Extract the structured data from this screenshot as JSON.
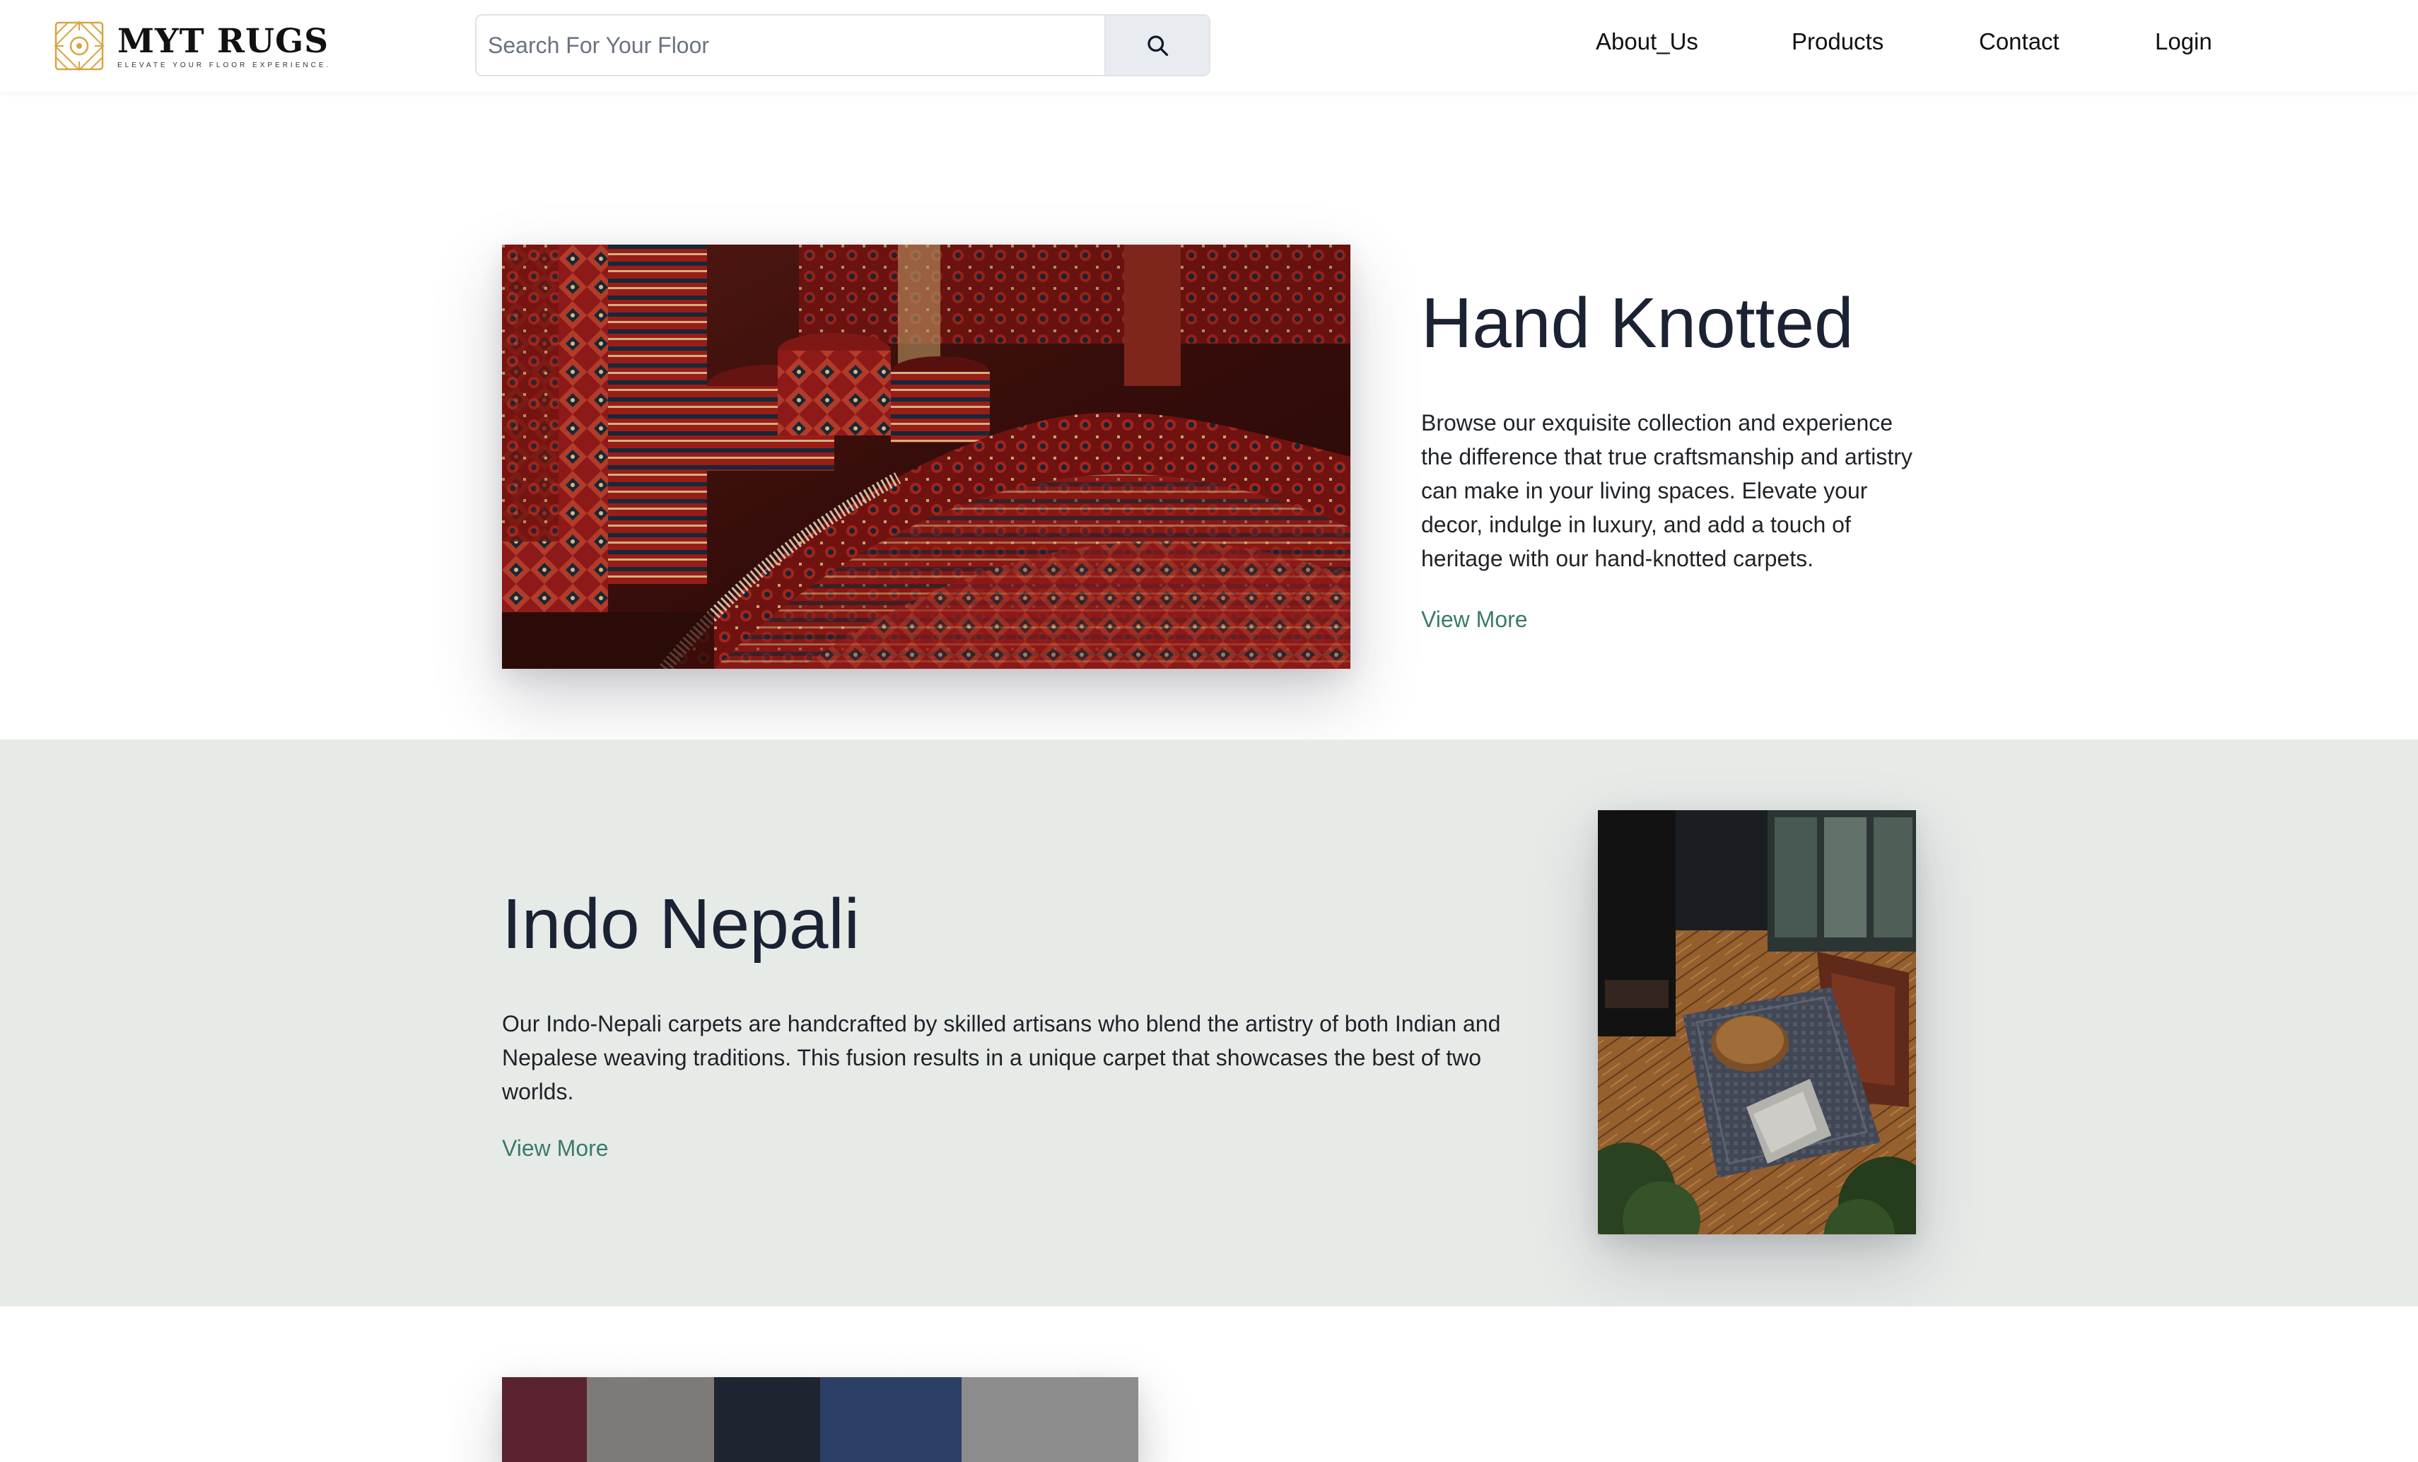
{
  "brand": {
    "name": "MYT RUGS",
    "tagline": "ELEVATE YOUR FLOOR EXPERIENCE.",
    "icon": "rug-pattern-logo-icon",
    "accent_color": "#d9a441"
  },
  "search": {
    "placeholder": "Search For Your Floor",
    "value": "",
    "button_icon": "search-icon"
  },
  "nav": {
    "items": [
      {
        "label": "About_Us"
      },
      {
        "label": "Products"
      },
      {
        "label": "Contact"
      },
      {
        "label": "Login"
      }
    ]
  },
  "sections": [
    {
      "title": "Hand Knotted",
      "description": "Browse our exquisite collection and experience the difference that true craftsmanship and artistry can make in your living spaces. Elevate your decor, indulge in luxury, and add a touch of heritage with our hand-knotted carpets.",
      "link_label": "View More",
      "image": "red-persian-rugs-photo"
    },
    {
      "title": "Indo Nepali",
      "description": "Our Indo-Nepali carpets are handcrafted by skilled artisans who blend the artistry of both Indian and Nepalese weaving traditions. This fusion results in a unique carpet that showcases the best of two worlds.",
      "link_label": "View More",
      "image": "living-room-rug-photo"
    },
    {
      "image": "rug-collection-photo"
    }
  ],
  "colors": {
    "link": "#3b7a6c",
    "alt_section_bg": "#e7ebe8",
    "heading": "#1a2233"
  }
}
